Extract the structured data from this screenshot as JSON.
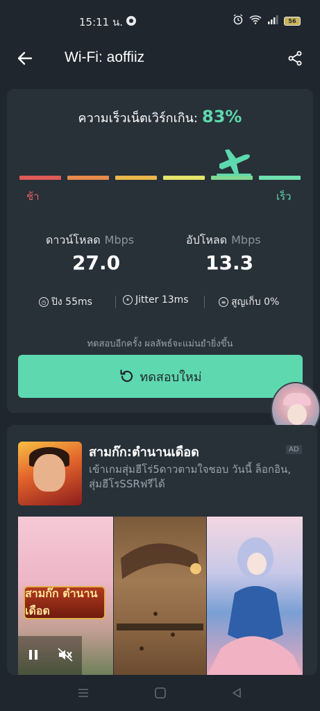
{
  "status_bar": {
    "time": "15:11 น.",
    "battery": "56"
  },
  "app_bar": {
    "title": "Wi-Fi: aoffiiz",
    "back_icon": "arrow-left-icon",
    "share_icon": "share-icon"
  },
  "speed_card": {
    "quality_label": "ความเร็วเน็ตเวิร์กเกิน:",
    "quality_percent": "83%",
    "quality_fraction": 0.83,
    "scale_slow_label": "ช้า",
    "scale_fast_label": "เร็ว",
    "scale_colors": [
      "#e05a5a",
      "#e88a4a",
      "#e9b84a",
      "#e6e46a",
      "#7ed892",
      "#6fe0b0"
    ],
    "active_segment": 5,
    "download": {
      "label": "ดาวน์โหลด",
      "unit": "Mbps",
      "value": "27.0"
    },
    "upload": {
      "label": "อัปโหลด",
      "unit": "Mbps",
      "value": "13.3"
    },
    "stats": {
      "ping": "ปิง 55ms",
      "jitter": "Jitter 13ms",
      "loss": "สูญเก็บ 0%"
    },
    "retest_hint": "ทดสอบอีกครั้ง ผลลัพธ์จะแม่นยำยิ่งขึ้น",
    "retest_button": "ทดสอบใหม่"
  },
  "ad": {
    "title": "สามก๊ก:ตำนานเดือด",
    "badge": "AD",
    "description": "เข้าเกมสุ่มฮีโร่5ดาวตามใจชอบ วันนี้ ล็อกอิน, สุ่มฮีโรSSRฟรีได้",
    "logo_text": "สามก๊ก ตำนานเดือด"
  },
  "colors": {
    "accent": "#5ed8ae",
    "background": "#1f262d",
    "card": "#283038",
    "slow": "#e46060"
  }
}
